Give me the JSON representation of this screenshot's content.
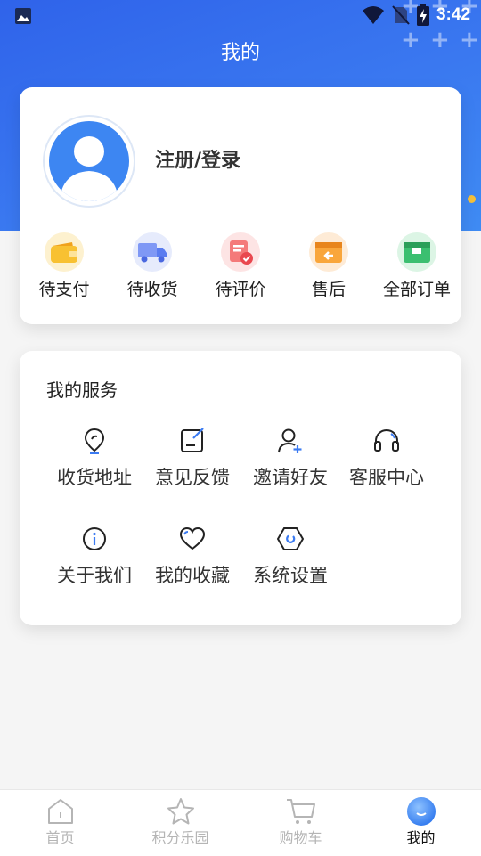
{
  "status_bar": {
    "time": "3:42",
    "icons": [
      "image-icon",
      "wifi-icon",
      "no-sim-icon",
      "battery-charging-icon"
    ]
  },
  "header": {
    "title": "我的",
    "gradient_colors": [
      "#2f63ea",
      "#3f8bf3"
    ]
  },
  "profile": {
    "login_label": "注册/登录",
    "avatar_icon": "user-avatar-icon"
  },
  "orders": [
    {
      "label": "待支付",
      "icon": "wallet-icon",
      "color": "#f7b42c"
    },
    {
      "label": "待收货",
      "icon": "truck-icon",
      "color": "#5a7cf0"
    },
    {
      "label": "待评价",
      "icon": "review-icon",
      "color": "#ef5a5a"
    },
    {
      "label": "售后",
      "icon": "after-sale-icon",
      "color": "#f79a2c"
    },
    {
      "label": "全部订单",
      "icon": "all-orders-icon",
      "color": "#34b96a"
    }
  ],
  "services": {
    "title": "我的服务",
    "items": [
      {
        "label": "收货地址",
        "icon": "location-pin-icon"
      },
      {
        "label": "意见反馈",
        "icon": "feedback-edit-icon"
      },
      {
        "label": "邀请好友",
        "icon": "add-user-icon"
      },
      {
        "label": "客服中心",
        "icon": "headset-icon"
      },
      {
        "label": "关于我们",
        "icon": "info-icon"
      },
      {
        "label": "我的收藏",
        "icon": "heart-icon"
      },
      {
        "label": "系统设置",
        "icon": "settings-hexagon-icon"
      }
    ],
    "accent_color": "#3b7bf2"
  },
  "tabbar": {
    "items": [
      {
        "label": "首页",
        "icon": "home-icon",
        "active": false
      },
      {
        "label": "积分乐园",
        "icon": "star-icon",
        "active": false
      },
      {
        "label": "购物车",
        "icon": "cart-icon",
        "active": false
      },
      {
        "label": "我的",
        "icon": "profile-ball-icon",
        "active": true
      }
    ],
    "inactive_color": "#b5b5b5",
    "active_color": "#111111"
  }
}
